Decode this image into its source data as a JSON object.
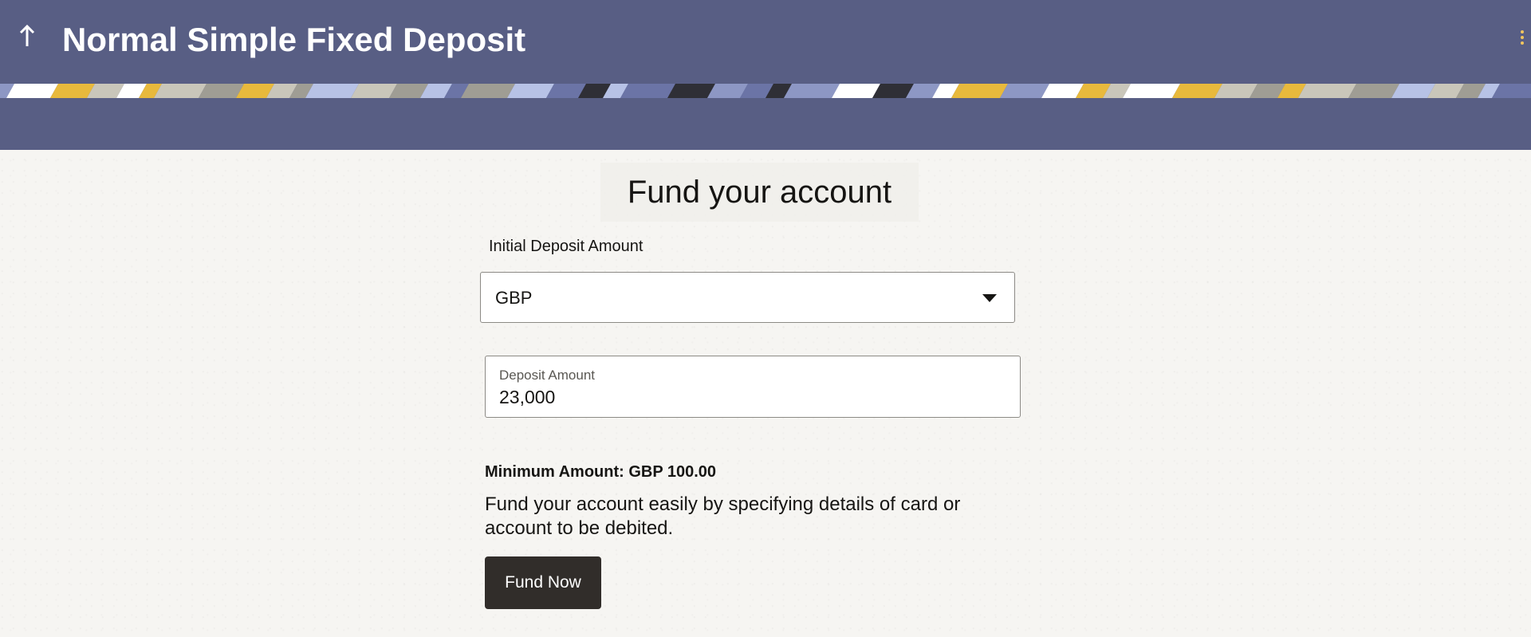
{
  "header": {
    "back_icon": "arrow-up-icon",
    "title": "Normal Simple Fixed Deposit",
    "menu_icon": "kebab-menu-icon",
    "background_color": "#585e84",
    "accent_color": "#f2c65e"
  },
  "fund": {
    "title": "Fund your account",
    "initial_deposit_label": "Initial Deposit Amount",
    "currency": {
      "selected": "GBP"
    },
    "deposit_amount": {
      "label": "Deposit Amount",
      "value": "23,000"
    },
    "minimum_amount": "Minimum Amount: GBP 100.00",
    "description": "Fund your account easily by specifying details of card or account to be debited.",
    "fund_now_label": "Fund Now",
    "button_color": "#312d2a"
  }
}
